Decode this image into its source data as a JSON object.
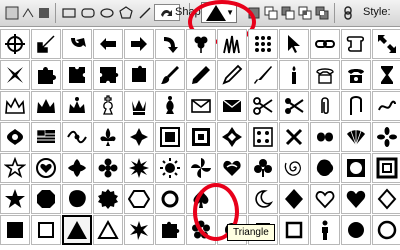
{
  "toolbar": {
    "shape_label": "Shape:",
    "style_label": "Style:",
    "selected_shape": "triangle-icon"
  },
  "tooltip": {
    "text": "Triangle"
  },
  "highlight_color": "#e8001a",
  "grid": {
    "columns": 13,
    "rows": 7,
    "shapes": [
      [
        "crosshair",
        "arrow-sw",
        "hook-arrow",
        "arrow-left-curly",
        "arrow-right-thick",
        "arrow-down-curved",
        "leaf-clover",
        "grass",
        "dots",
        "cursor-arrow",
        "link",
        "scroll",
        "arrows-corner"
      ],
      [
        "cross-ribbon",
        "puzzle-1",
        "puzzle-2",
        "puzzle-3",
        "puzzle-4",
        "brush",
        "pencil",
        "pen",
        "knife",
        "candle",
        "telephone-outline",
        "telephone",
        "hourglass"
      ],
      [
        "crown-1",
        "crown-2",
        "crown-3",
        "chess-king",
        "chess-queen",
        "chess-bishop",
        "envelope-outline",
        "envelope",
        "scissors",
        "scissors-2",
        "paperclip",
        "clip",
        "rope"
      ],
      [
        "ornament-1",
        "flag",
        "ornament-2",
        "fleur-de-lis",
        "ornament-3",
        "frame",
        "frame-2",
        "diamond-ornament",
        "dots-square",
        "ribbon",
        "ornament-4",
        "fan",
        "flower-2"
      ],
      [
        "star-outline",
        "heart-circle",
        "ornament-5",
        "flower",
        "starburst",
        "sun",
        "pinwheel",
        "heart-wave",
        "club",
        "spiral",
        "ink-blot",
        "frame-3",
        "frame-4"
      ],
      [
        "star",
        "octagon",
        "blob",
        "seal",
        "hexagon",
        "ring",
        "spade",
        "crescent",
        "moon",
        "diamond",
        "heart-outline",
        "heart",
        "diamond-outline"
      ],
      [
        "square",
        "square-outline",
        "triangle",
        "triangle-outline",
        "splat",
        "puzzle-5",
        "flower-3",
        "ring-2",
        "square-2",
        "square-outline-2",
        "person",
        "circle",
        "circle-outline"
      ]
    ]
  }
}
